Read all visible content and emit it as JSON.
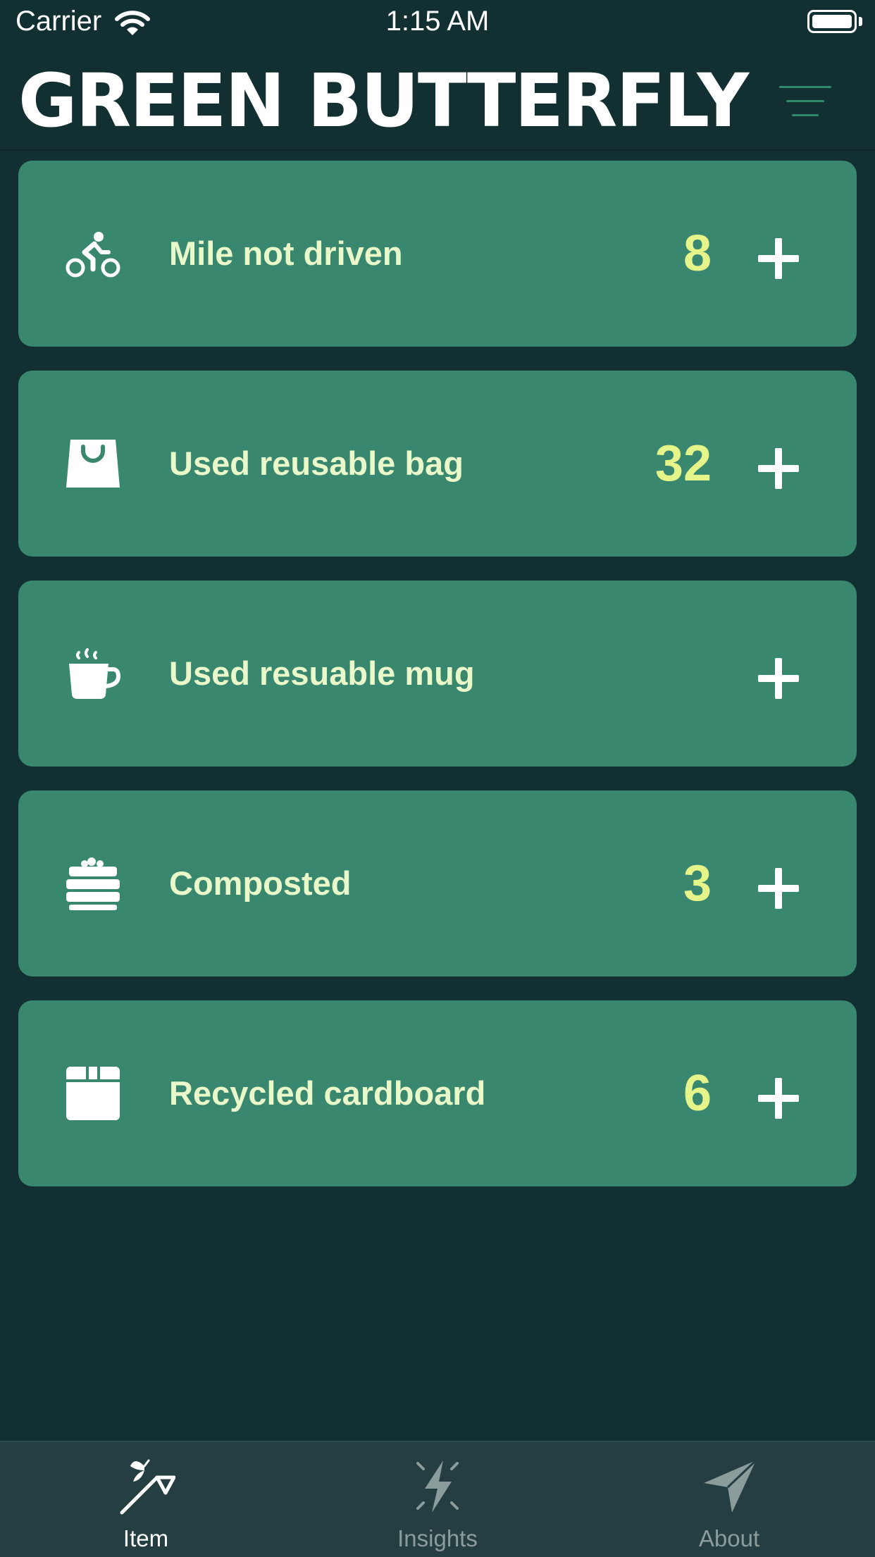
{
  "status_bar": {
    "carrier": "Carrier",
    "time": "1:15 AM"
  },
  "header": {
    "title": "GREEN BUTTERFLY",
    "menu_icon": "hamburger-menu-icon"
  },
  "items": [
    {
      "label": "Mile not driven",
      "count": "8",
      "icon": "bicycle-rider-icon"
    },
    {
      "label": "Used reusable bag",
      "count": "32",
      "icon": "shopping-bag-icon"
    },
    {
      "label": "Used resuable mug",
      "count": "",
      "icon": "coffee-mug-icon"
    },
    {
      "label": "Composted",
      "count": "3",
      "icon": "compost-bin-icon"
    },
    {
      "label": "Recycled cardboard",
      "count": "6",
      "icon": "cardboard-box-icon"
    }
  ],
  "tabs": [
    {
      "label": "Item",
      "icon": "butterfly-net-icon",
      "selected": true
    },
    {
      "label": "Insights",
      "icon": "lightning-bolt-icon",
      "selected": false
    },
    {
      "label": "About",
      "icon": "paper-plane-icon",
      "selected": false
    }
  ],
  "colors": {
    "background": "#122f31",
    "card": "#38876e",
    "label": "#e9f9c9",
    "count": "#e5f58a",
    "tab_bar": "#243e41",
    "tab_selected": "#ffffff",
    "tab_unselected": "#8b9c9d",
    "menu_icon": "#2f8a6c"
  }
}
